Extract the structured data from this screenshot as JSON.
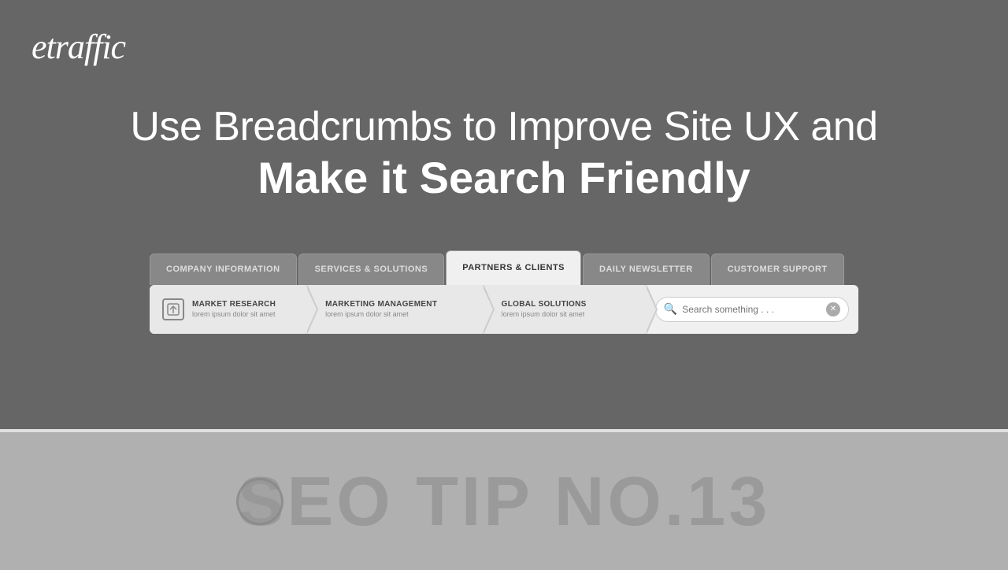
{
  "logo": {
    "text": "etraffic"
  },
  "headline": {
    "line1": "Use Breadcrumbs to Improve Site UX and",
    "line2": "Make it Search Friendly"
  },
  "nav_tabs": {
    "items": [
      {
        "id": "company-information",
        "label": "COMPANY INFORMATION",
        "active": false
      },
      {
        "id": "services-solutions",
        "label": "SERVICES & SOLUTIONS",
        "active": false
      },
      {
        "id": "partners-clients",
        "label": "PARTNERS & CLIENTS",
        "active": true
      },
      {
        "id": "daily-newsletter",
        "label": "DAILY NEWSLETTER",
        "active": false
      },
      {
        "id": "customer-support",
        "label": "CUSTOMER SUPPORT",
        "active": false
      }
    ]
  },
  "content_items": [
    {
      "id": "market-research",
      "title": "MARKET RESEARCH",
      "subtitle": "lorem ipsum dolor sit amet",
      "has_icon": true
    },
    {
      "id": "marketing-management",
      "title": "MARKETING MANAGEMENT",
      "subtitle": "lorem ipsum dolor sit amet",
      "has_icon": false
    },
    {
      "id": "global-solutions",
      "title": "GLOBAL SOLUTIONS",
      "subtitle": "lorem ipsum dolor sit amet",
      "has_icon": false
    }
  ],
  "search": {
    "placeholder": "Search something . . ."
  },
  "seo_tip": {
    "text": "SEO TIP NO.13"
  }
}
